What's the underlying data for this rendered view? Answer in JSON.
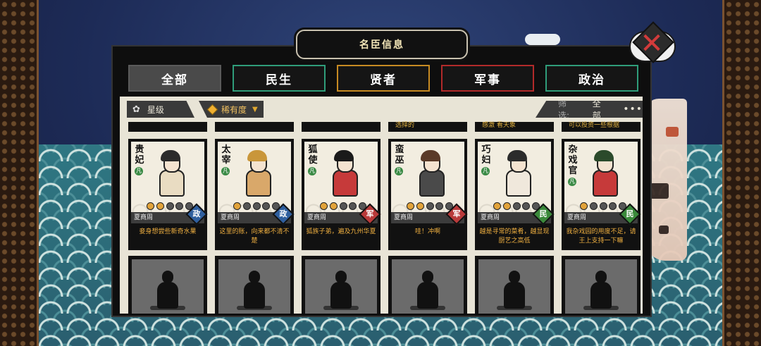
{
  "window": {
    "title": "名臣信息"
  },
  "tabs": [
    {
      "label": "全部",
      "active": true
    },
    {
      "label": "民生",
      "color": "#2f9d7a"
    },
    {
      "label": "贤者",
      "color": "#c78a22"
    },
    {
      "label": "军事",
      "color": "#b22a2a"
    },
    {
      "label": "政治",
      "color": "#2f9d7a"
    }
  ],
  "filters": {
    "star_label": "星级",
    "rarity_label": "稀有度",
    "filter_label": "筛选:",
    "filter_value": "全部",
    "more_icon": "•••"
  },
  "prev_row_fragments": [
    "",
    "",
    "",
    "选择的",
    "感激 看天象",
    "可以投资一些根据"
  ],
  "ministers": [
    {
      "name": "贵妃",
      "rank": "凡",
      "stars": 2,
      "dynasty": "夏商周",
      "category": "政",
      "category_type": "zheng",
      "desc": "妾身想尝些新奇水果",
      "hair": "#2b2b2b",
      "robe": "#e9dcc2"
    },
    {
      "name": "太宰",
      "rank": "凡",
      "stars": 1,
      "dynasty": "夏商周",
      "category": "政",
      "category_type": "zheng",
      "desc": "这里的账，向来都不清不楚",
      "hair": "#c9963a",
      "robe": "#d9a86a"
    },
    {
      "name": "狐使",
      "rank": "凡",
      "stars": 2,
      "dynasty": "夏商周",
      "category": "军",
      "category_type": "jun",
      "desc": "狐族子弟，遍及九州华夏",
      "hair": "#1a1a1a",
      "robe": "#c63a3a"
    },
    {
      "name": "蛮巫",
      "rank": "凡",
      "stars": 2,
      "dynasty": "夏商周",
      "category": "军",
      "category_type": "jun",
      "desc": "哇！冲啊",
      "hair": "#5a3a28",
      "robe": "#4a4a4a"
    },
    {
      "name": "巧妇",
      "rank": "凡",
      "stars": 2,
      "dynasty": "夏商周",
      "category": "民",
      "category_type": "min",
      "desc": "越是寻常的菜肴，越显现厨艺之高低",
      "hair": "#2b2b2b",
      "robe": "#f0e8dc"
    },
    {
      "name": "杂戏官",
      "rank": "凡",
      "stars": 1,
      "dynasty": "夏商周",
      "category": "民",
      "category_type": "min",
      "desc": "我杂戏园的用度不足，请王上支持一下嘛",
      "hair": "#2b4a2b",
      "robe": "#c63a3a"
    }
  ],
  "colors": {
    "tab_active_bg": "#4a4a4a",
    "gold_text": "#f0b040",
    "panel_bg": "#0e0e0e",
    "content_bg": "#e8e4d6"
  },
  "icons": {
    "close": "close-icon",
    "star_filter": "flower-icon",
    "rarity": "diamond-icon",
    "dropdown": "triangle-down-icon"
  }
}
